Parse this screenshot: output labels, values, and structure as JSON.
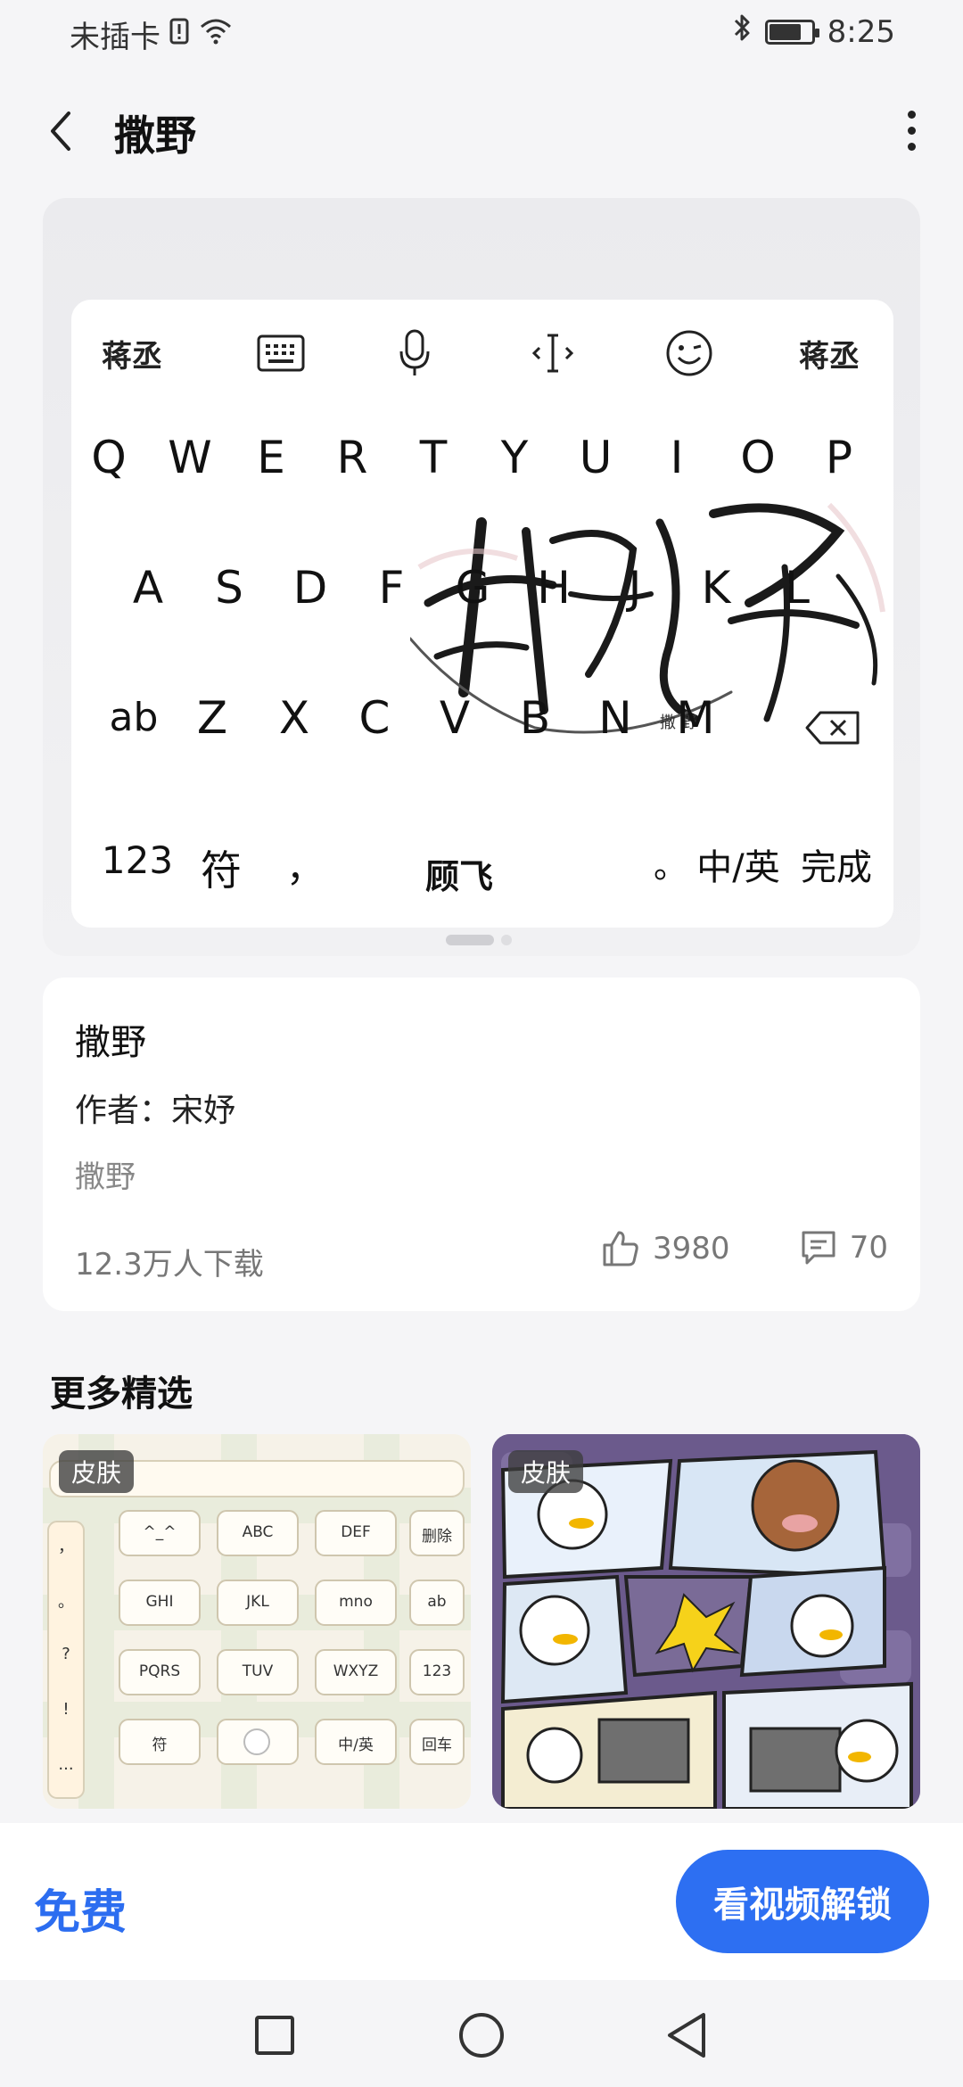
{
  "status": {
    "carrier": "未插卡",
    "time": "8:25",
    "battery_level": 0.75
  },
  "header": {
    "title": "撒野"
  },
  "keyboard_preview": {
    "toolbar": [
      "蒋丞",
      "keyboard-icon",
      "microphone-icon",
      "cursor-icon",
      "emoji-icon",
      "蒋丞"
    ],
    "row1": [
      "Q",
      "W",
      "E",
      "R",
      "T",
      "Y",
      "U",
      "I",
      "O",
      "P"
    ],
    "row2": [
      "A",
      "S",
      "D",
      "F",
      "G",
      "H",
      "J",
      "K",
      "L"
    ],
    "row3": [
      "ab",
      "Z",
      "X",
      "C",
      "V",
      "B",
      "N",
      "M"
    ],
    "row4": [
      "123",
      "符",
      "，",
      "顾飞",
      "。",
      "中/英",
      "完成"
    ],
    "art_text": "撒野",
    "art_small": "撒 野",
    "pages": 2,
    "active_page": 1
  },
  "info": {
    "name": "撒野",
    "author": "作者：宋妤",
    "description": "撒野",
    "downloads": "12.3万人下载",
    "likes": "3980",
    "comments": "70"
  },
  "more": {
    "title": "更多精选",
    "items": [
      {
        "tag": "皮肤"
      },
      {
        "tag": "皮肤"
      }
    ],
    "thumb1": {
      "left_col": [
        "，",
        "。",
        "?",
        "!",
        "..."
      ],
      "keys": [
        [
          "^_^",
          "ABC",
          "DEF",
          "删除"
        ],
        [
          "GHI",
          "JKL",
          "mno",
          "ab"
        ],
        [
          "PQRS",
          "TUV",
          "WXYZ",
          "123"
        ],
        [
          "符",
          "",
          "中/英",
          "回车"
        ]
      ]
    }
  },
  "action": {
    "price": "免费",
    "unlock": "看视频解锁"
  },
  "colors": {
    "accent": "#2d6ff2",
    "price": "#2c6df0"
  }
}
